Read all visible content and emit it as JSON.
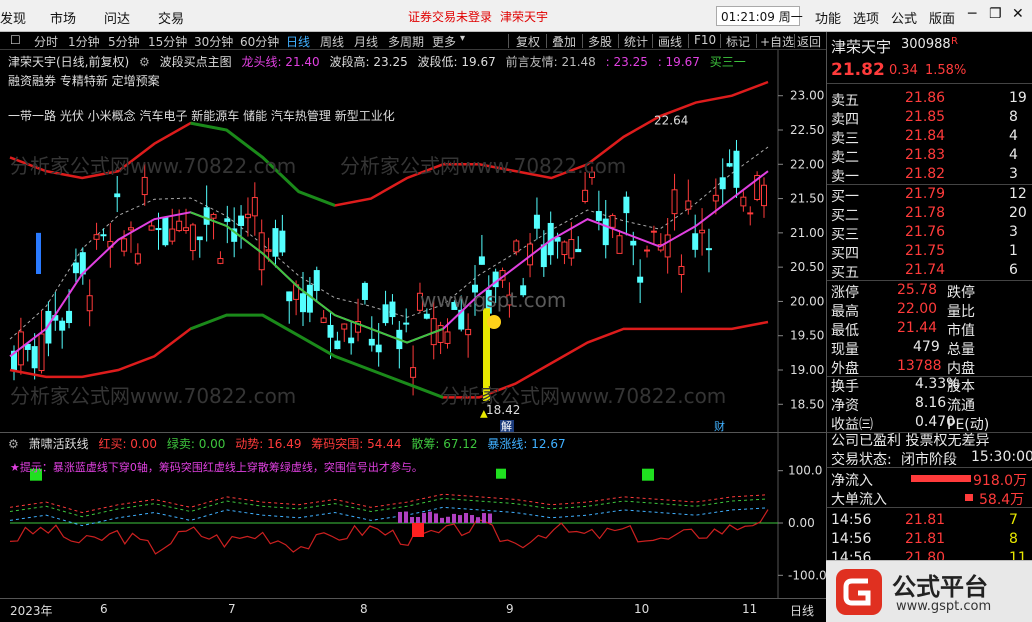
{
  "topbar": {
    "menu_left": "发现",
    "menu_items": [
      "市场",
      "问达",
      "交易"
    ],
    "notice": "证券交易未登录",
    "notice_name": "津荣天宇",
    "clock": "01:21:09 周一",
    "right_menu": [
      "功能",
      "选项",
      "公式",
      "版面"
    ]
  },
  "period_bar": {
    "items": [
      "分时",
      "1分钟",
      "5分钟",
      "15分钟",
      "30分钟",
      "60分钟",
      "日线",
      "周线",
      "月线",
      "多周期",
      "更多"
    ],
    "active": "日线",
    "tools": [
      "复权",
      "叠加",
      "多股",
      "统计",
      "画线",
      "F10",
      "标记",
      "+自选",
      "返回"
    ]
  },
  "main_chart": {
    "title": "津荣天宇(日线,前复权)",
    "indicator": "波段买点主图",
    "dragon": "龙头线: 21.40",
    "high": "波段高: 23.25",
    "low": "波段低: 19.67",
    "prev": "前言友情: 21.48",
    "tail1": ": 23.25",
    "tail2": ": 19.67",
    "tail3": "买三一",
    "tags": "融资融券 专精特新 定增预案",
    "concepts": "一带一路 光伏 小米概念 汽车电子 新能源车 储能 汽车热管理 新型工业化",
    "max_label": "22.64",
    "min_label": "18.42",
    "marker_jie": "解",
    "marker_cai": "财",
    "watermarks": [
      "分析家公式网www.70822.com",
      "分析家公式网www.70822.com",
      "www.gspt.com",
      "分析家公式网www.70822.com",
      "分析家公式网www.70822.com"
    ],
    "y_ticks": [
      "23.00",
      "22.50",
      "22.00",
      "21.50",
      "21.00",
      "20.50",
      "20.00",
      "19.50",
      "19.00",
      "18.50"
    ]
  },
  "sub_chart": {
    "name": "萧啸活跃线",
    "hongmai": "红买: 0.00",
    "lvmai": "绿卖: 0.00",
    "dongshi": "动势: 16.49",
    "choumai": "筹码突围: 54.44",
    "sanduo": "散筹: 67.12",
    "baozhang": "暴涨线: 12.67",
    "warn": "★提示：暴涨蓝虚线下穿0轴，筹码突围红虚线上穿散筹绿虚线，突围信号出才参与。",
    "y_ticks": [
      "100.0",
      "0.00",
      "-100.0"
    ]
  },
  "chart_data": [
    {
      "type": "line",
      "title": "津荣天宇(日线,前复权)",
      "ylim": [
        18.3,
        23.2
      ],
      "x": [
        "2023年",
        "6",
        "7",
        "8",
        "9",
        "10",
        "11"
      ],
      "series": [
        {
          "name": "龙头线",
          "values": [
            19.2,
            19.6,
            20.4,
            20.9,
            21.2,
            21.3,
            21.1,
            20.7,
            20.2,
            19.8,
            19.6,
            19.4,
            19.6,
            20.1,
            20.5,
            20.9,
            21.2,
            21.0,
            20.8,
            21.1,
            21.5,
            21.9
          ]
        },
        {
          "name": "波段高",
          "values": [
            22.1,
            21.9,
            21.8,
            21.9,
            22.3,
            22.6,
            22.5,
            22.1,
            21.6,
            21.4,
            21.5,
            21.8,
            22.0,
            22.0,
            21.9,
            21.8,
            22.0,
            22.4,
            22.7,
            22.9,
            23.0,
            23.2
          ]
        },
        {
          "name": "波段低",
          "values": [
            19.0,
            18.9,
            18.9,
            19.0,
            19.2,
            19.6,
            19.8,
            19.8,
            19.5,
            19.2,
            19.0,
            18.8,
            18.6,
            18.6,
            18.8,
            19.1,
            19.4,
            19.6,
            19.6,
            19.6,
            19.6,
            19.7
          ]
        }
      ]
    },
    {
      "type": "line",
      "title": "萧啸活跃线",
      "ylim": [
        -130,
        130
      ],
      "series": [
        {
          "name": "动势",
          "values": [
            -30,
            -10,
            -40,
            -20,
            -50,
            -15,
            -35,
            -20,
            -45,
            -25,
            -10,
            -30,
            -20,
            -5,
            -40,
            -10,
            -25,
            -15,
            -35,
            -20,
            -10,
            15
          ]
        },
        {
          "name": "筹码突围",
          "values": [
            30,
            40,
            20,
            35,
            45,
            30,
            50,
            40,
            35,
            45,
            30,
            40,
            55,
            50,
            45,
            35,
            40,
            50,
            45,
            40,
            50,
            54
          ]
        }
      ]
    }
  ],
  "side": {
    "name": "津荣天宇",
    "code": "300988",
    "r_tag": "R",
    "price": "21.82",
    "chg": "0.34",
    "pct": "1.58%",
    "asks": [
      [
        "卖五",
        "21.86",
        "19"
      ],
      [
        "卖四",
        "21.85",
        "8"
      ],
      [
        "卖三",
        "21.84",
        "4"
      ],
      [
        "卖二",
        "21.83",
        "4"
      ],
      [
        "卖一",
        "21.82",
        "3"
      ]
    ],
    "bids": [
      [
        "买一",
        "21.79",
        "12"
      ],
      [
        "买二",
        "21.78",
        "20"
      ],
      [
        "买三",
        "21.76",
        "3"
      ],
      [
        "买四",
        "21.75",
        "1"
      ],
      [
        "买五",
        "21.74",
        "6"
      ]
    ],
    "stats": [
      [
        "涨停",
        "25.78",
        "跌停"
      ],
      [
        "最高",
        "22.00",
        "量比"
      ],
      [
        "最低",
        "21.44",
        "市值"
      ],
      [
        "现量",
        "479",
        "总量"
      ],
      [
        "外盘",
        "13788",
        "内盘"
      ]
    ],
    "stats2": [
      [
        "换手",
        "4.33%",
        "股本"
      ],
      [
        "净资",
        "8.16",
        "流通"
      ],
      [
        "收益㈢",
        "0.470",
        "PE(动)"
      ]
    ],
    "notice": "公司已盈利 投票权无差异",
    "status_label": "交易状态:",
    "status_val": "闭市阶段",
    "status_time": "15:30:00",
    "flow": [
      [
        "净流入",
        "918.0万"
      ],
      [
        "大单流入",
        "58.4万"
      ]
    ],
    "ticks": [
      [
        "14:56",
        "21.81",
        "7"
      ],
      [
        "14:56",
        "21.81",
        "8"
      ],
      [
        "14:56",
        "21.80",
        "11"
      ]
    ],
    "logo_text": "公式平台",
    "logo_url": "www.gspt.com"
  }
}
